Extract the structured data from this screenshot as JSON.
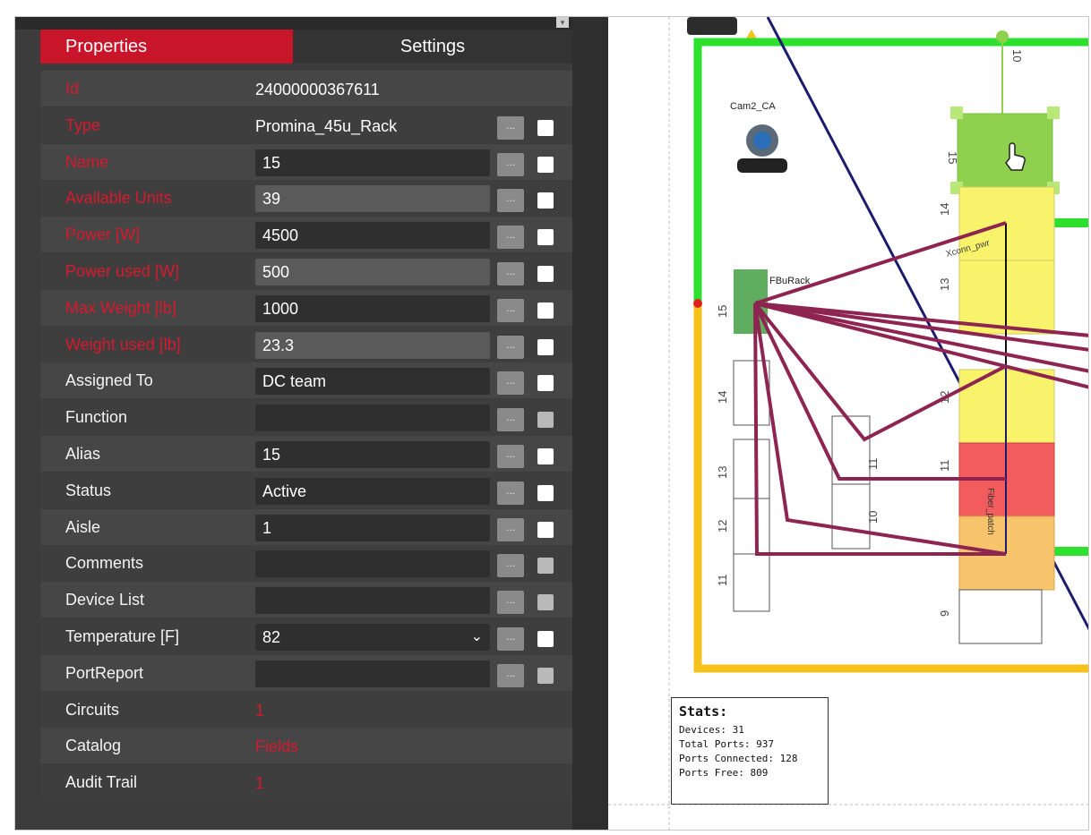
{
  "tabs": {
    "properties": "Properties",
    "settings": "Settings"
  },
  "edit_button_label": "...",
  "properties": [
    {
      "label": "Id",
      "value": "24000000367611",
      "required": true,
      "style": "plain",
      "button": false
    },
    {
      "label": "Type",
      "value": "Promina_45u_Rack",
      "required": true,
      "style": "plain",
      "button": true,
      "check": "white"
    },
    {
      "label": "Name",
      "value": "15",
      "required": true,
      "style": "box",
      "button": true,
      "check": "white"
    },
    {
      "label": "Available Units",
      "value": "39",
      "required": true,
      "style": "lite",
      "button": true,
      "check": "white"
    },
    {
      "label": "Power [W]",
      "value": "4500",
      "required": true,
      "style": "box",
      "button": true,
      "check": "white"
    },
    {
      "label": "Power used [W]",
      "value": "500",
      "required": true,
      "style": "lite",
      "button": true,
      "check": "white"
    },
    {
      "label": "Max Weight [lb]",
      "value": "1000",
      "required": true,
      "style": "box",
      "button": true,
      "check": "white"
    },
    {
      "label": "Weight used [lb]",
      "value": "23.3",
      "required": true,
      "style": "lite",
      "button": true,
      "check": "white"
    },
    {
      "label": "Assigned To",
      "value": "DC team",
      "required": false,
      "style": "box",
      "button": true,
      "check": "white"
    },
    {
      "label": "Function",
      "value": "",
      "required": false,
      "style": "box",
      "button": true,
      "check": "dim"
    },
    {
      "label": "Alias",
      "value": "15",
      "required": false,
      "style": "box",
      "button": true,
      "check": "white"
    },
    {
      "label": "Status",
      "value": "Active",
      "required": false,
      "style": "box",
      "button": true,
      "check": "white"
    },
    {
      "label": "Aisle",
      "value": "1",
      "required": false,
      "style": "box",
      "button": true,
      "check": "white"
    },
    {
      "label": "Comments",
      "value": "",
      "required": false,
      "style": "box",
      "button": true,
      "check": "dim"
    },
    {
      "label": "Device List",
      "value": "",
      "required": false,
      "style": "box",
      "button": true,
      "check": "dim"
    },
    {
      "label": "Temperature [F]",
      "value": "82",
      "required": false,
      "style": "select",
      "button": true,
      "check": "white"
    },
    {
      "label": "PortReport",
      "value": "",
      "required": false,
      "style": "box",
      "button": true,
      "check": "dim"
    },
    {
      "label": "Circuits",
      "value": "1",
      "required": false,
      "style": "link",
      "button": false
    },
    {
      "label": "Catalog",
      "value": "Fields",
      "required": false,
      "style": "link",
      "button": false
    },
    {
      "label": "Audit Trail",
      "value": "1",
      "required": false,
      "style": "link",
      "button": false
    }
  ],
  "canvas": {
    "camera_label": "Cam2_CA",
    "rack_label_a": "FBuRack",
    "rack_label_b": "Xconn_pwr",
    "rack_label_c": "Fiber_patch",
    "unit_labels": [
      "10",
      "15",
      "14",
      "13",
      "12",
      "11",
      "9"
    ],
    "left_labels": [
      "15",
      "14",
      "13",
      "12",
      "11"
    ],
    "mid_labels": [
      "11",
      "10"
    ],
    "colors": {
      "green": "#2ee02e",
      "yellow_border": "#f4c21a",
      "selected": "#8fd14f",
      "yellow_unit": "#f8f36a",
      "red_unit": "#f25c5c",
      "orange_unit": "#f7c46b",
      "cable": "#8e2450",
      "diagonal": "#1c1c6e"
    }
  },
  "stats": {
    "title": "Stats:",
    "devices": "Devices: 31",
    "total_ports": "Total Ports: 937",
    "ports_connected": "Ports Connected: 128",
    "ports_free": "Ports Free: 809"
  }
}
